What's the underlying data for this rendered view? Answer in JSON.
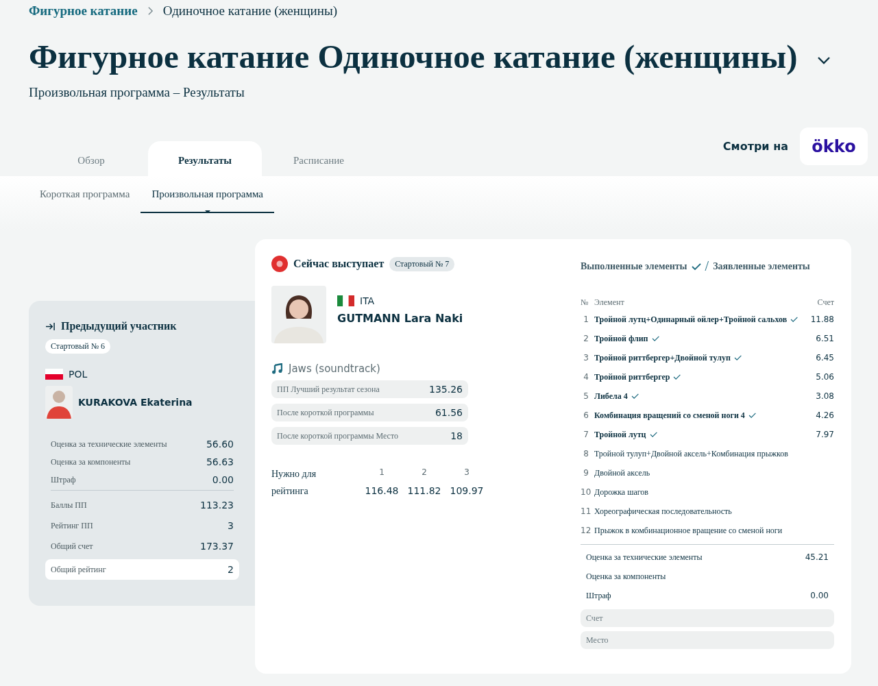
{
  "breadcrumb": [
    {
      "label": "Фигурное катание",
      "kind": "link"
    },
    {
      "label": "Одиночное катание (женщины)",
      "kind": "current"
    }
  ],
  "title": "Фигурное катание Одиночное катание (женщины)",
  "subtitle": "Произвольная программа – Результаты",
  "tabs": [
    {
      "label": "Обзор",
      "selected": false
    },
    {
      "label": "Результаты",
      "selected": true
    },
    {
      "label": "Расписание",
      "selected": false
    }
  ],
  "watch": {
    "label": "Смотри на",
    "logo": "ökko"
  },
  "subtabs": [
    {
      "label": "Короткая программа",
      "selected": false
    },
    {
      "label": "Произвольная программа",
      "selected": true
    }
  ],
  "previous": {
    "heading": "Предыдущий участник",
    "start_badge": "Стартовый № 6",
    "country": "POL",
    "name": "KURAKOVA Ekaterina",
    "stats": [
      {
        "label": "Оценка за технические элементы",
        "value": "56.60",
        "kind": "plain"
      },
      {
        "label": "Оценка за компоненты",
        "value": "56.63",
        "kind": "plain"
      },
      {
        "label": "Штраф",
        "value": "0.00",
        "kind": "plain"
      },
      {
        "label": "Баллы ПП",
        "value": "113.23",
        "kind": "divided"
      },
      {
        "label": "Рейтинг ПП",
        "value": "3",
        "kind": "plain"
      },
      {
        "label": "Общий счет",
        "value": "173.37",
        "kind": "plain"
      },
      {
        "label": "Общий рейтинг",
        "value": "2",
        "kind": "highlight"
      }
    ]
  },
  "current": {
    "heading": "Сейчас выступает",
    "start_badge": "Стартовый № 7",
    "country": "ITA",
    "name": "GUTMANN Lara Naki",
    "music": "Jaws (soundtrack)",
    "stats": [
      {
        "label": "ПП Лучший результат сезона",
        "value": "135.26"
      },
      {
        "label": "После короткой программы",
        "value": "61.56"
      },
      {
        "label": "После короткой программы Место",
        "value": "18"
      }
    ],
    "needed": {
      "label": "Нужно для рейтинга",
      "places": [
        {
          "place": "1",
          "value": "116.48"
        },
        {
          "place": "2",
          "value": "111.82"
        },
        {
          "place": "3",
          "value": "109.97"
        }
      ]
    }
  },
  "elements": {
    "performed_label": "Выполненные элементы",
    "separator": "/",
    "planned_label": "Заявленные элементы",
    "columns": [
      "№",
      "Элемент",
      "Счет"
    ],
    "rows": [
      {
        "no": "1",
        "name": "Тройной лутц+Одинарный ойлер+Тройной сальхов",
        "score": "11.88",
        "performed": true
      },
      {
        "no": "2",
        "name": "Тройной флип",
        "score": "6.51",
        "performed": true
      },
      {
        "no": "3",
        "name": "Тройной риттбергер+Двойной тулуп",
        "score": "6.45",
        "performed": true
      },
      {
        "no": "4",
        "name": "Тройной риттбергер",
        "score": "5.06",
        "performed": true
      },
      {
        "no": "5",
        "name": "Либела 4",
        "score": "3.08",
        "performed": true
      },
      {
        "no": "6",
        "name": "Комбинация вращений со сменой ноги 4",
        "score": "4.26",
        "performed": true
      },
      {
        "no": "7",
        "name": "Тройной лутц",
        "score": "7.97",
        "performed": true
      },
      {
        "no": "8",
        "name": "Тройной тулуп+Двойной аксель+Комбинация прыжков",
        "performed": false
      },
      {
        "no": "9",
        "name": "Двойной аксель",
        "performed": false
      },
      {
        "no": "10",
        "name": "Дорожка шагов",
        "performed": false
      },
      {
        "no": "11",
        "name": "Хореографическая последовательность",
        "performed": false
      },
      {
        "no": "12",
        "name": "Прыжок в комбинационное вращение со сменой ноги",
        "performed": false
      }
    ],
    "summary": [
      {
        "label": "Оценка за технические элементы",
        "value": "45.21",
        "kind": "plain"
      },
      {
        "label": "Оценка за компоненты",
        "kind": "plain"
      },
      {
        "label": "Штраф",
        "value": "0.00",
        "kind": "plain"
      },
      {
        "label": "Счет",
        "kind": "pill"
      },
      {
        "label": "Место",
        "kind": "pill"
      }
    ]
  }
}
